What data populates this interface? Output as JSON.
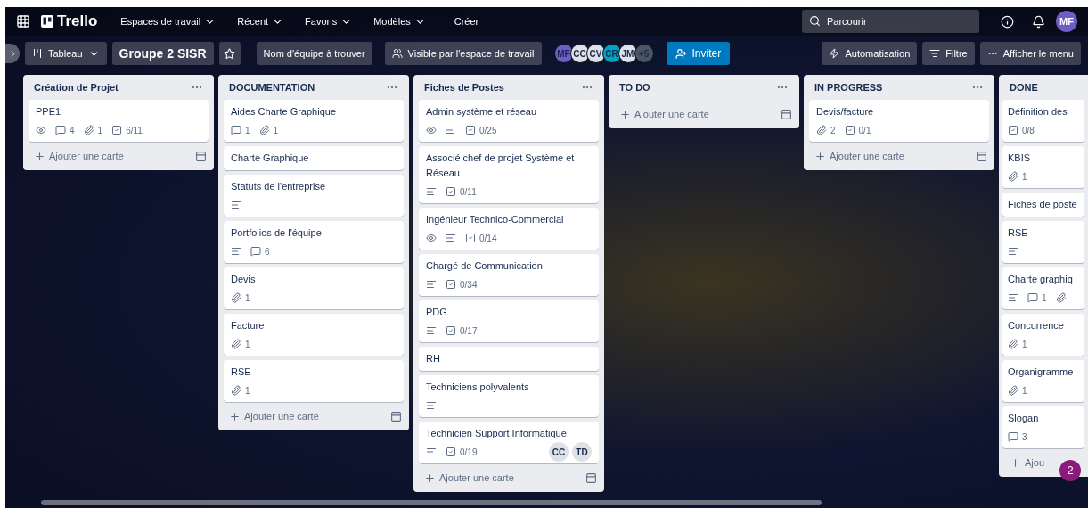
{
  "topbar": {
    "logo": "Trello",
    "menus": [
      {
        "label": "Espaces de travail",
        "kind": "menu"
      },
      {
        "label": "Récent",
        "kind": "menu"
      },
      {
        "label": "Favoris",
        "kind": "menu"
      },
      {
        "label": "Modèles",
        "kind": "menu"
      },
      {
        "label": "Créer",
        "kind": "button"
      }
    ],
    "search": {
      "placeholder": "Parcourir"
    },
    "user": "MF"
  },
  "boardbar": {
    "view": "Tableau",
    "title": "Groupe 2 SISR",
    "team": "Nom d'équipe à trouver",
    "visibility": "Visible par l'espace de travail",
    "members": [
      {
        "initials": "MF",
        "color": "#6e5dc6"
      },
      {
        "initials": "CC",
        "color": "#dfe1e6"
      },
      {
        "initials": "CV",
        "color": "#dfe1e6"
      },
      {
        "initials": "CR",
        "color": "#00a3bf"
      },
      {
        "initials": "JM",
        "color": "#dfe1e6"
      },
      {
        "initials": "+5",
        "color": "#4b5563"
      }
    ],
    "invite": "Inviter",
    "automation": "Automatisation",
    "filter": "Filtre",
    "menu": "Afficher le menu"
  },
  "lists": [
    {
      "title": "Création de Projet",
      "cards": [
        {
          "title": "PPE1",
          "badges": [
            {
              "kind": "watch"
            },
            {
              "kind": "comments",
              "count": "4"
            },
            {
              "kind": "attachments",
              "count": "1"
            },
            {
              "kind": "checklist",
              "count": "6/11"
            }
          ]
        }
      ],
      "add": "Ajouter une carte"
    },
    {
      "title": "DOCUMENTATION",
      "cards": [
        {
          "title": "Aides Charte Graphique",
          "badges": [
            {
              "kind": "comments",
              "count": "1"
            },
            {
              "kind": "attachments",
              "count": "1"
            }
          ]
        },
        {
          "title": "Charte Graphique"
        },
        {
          "title": "Statuts de l'entreprise",
          "badges": [
            {
              "kind": "description"
            }
          ]
        },
        {
          "title": "Portfolios de l'équipe",
          "badges": [
            {
              "kind": "description"
            },
            {
              "kind": "comments",
              "count": "6"
            }
          ]
        },
        {
          "title": "Devis",
          "badges": [
            {
              "kind": "attachments",
              "count": "1"
            }
          ]
        },
        {
          "title": "Facture",
          "badges": [
            {
              "kind": "attachments",
              "count": "1"
            }
          ]
        },
        {
          "title": "RSE",
          "badges": [
            {
              "kind": "attachments",
              "count": "1"
            }
          ]
        }
      ],
      "add": "Ajouter une carte"
    },
    {
      "title": "Fiches de Postes",
      "cards": [
        {
          "title": "Admin système et réseau",
          "badges": [
            {
              "kind": "watch"
            },
            {
              "kind": "description"
            },
            {
              "kind": "checklist",
              "count": "0/25"
            }
          ]
        },
        {
          "title": "Associé chef de projet Système et Réseau",
          "badges": [
            {
              "kind": "description"
            },
            {
              "kind": "checklist",
              "count": "0/11"
            }
          ]
        },
        {
          "title": "Ingénieur Technico-Commercial",
          "badges": [
            {
              "kind": "watch"
            },
            {
              "kind": "description"
            },
            {
              "kind": "checklist",
              "count": "0/14"
            }
          ]
        },
        {
          "title": "Chargé de Communication",
          "badges": [
            {
              "kind": "description"
            },
            {
              "kind": "checklist",
              "count": "0/34"
            }
          ]
        },
        {
          "title": "PDG",
          "badges": [
            {
              "kind": "description"
            },
            {
              "kind": "checklist",
              "count": "0/17"
            }
          ]
        },
        {
          "title": "RH"
        },
        {
          "title": "Techniciens polyvalents",
          "badges": [
            {
              "kind": "description"
            }
          ]
        },
        {
          "title": "Technicien Support Informatique",
          "badges": [
            {
              "kind": "description"
            },
            {
              "kind": "checklist",
              "count": "0/19"
            }
          ],
          "members": [
            "CC",
            "TD"
          ]
        }
      ],
      "add": "Ajouter une carte"
    },
    {
      "title": "TO DO",
      "add": "Ajouter une carte"
    },
    {
      "title": "IN PROGRESS",
      "cards": [
        {
          "title": "Devis/facture",
          "badges": [
            {
              "kind": "attachments",
              "count": "2"
            },
            {
              "kind": "checklist",
              "count": "0/1"
            }
          ]
        }
      ],
      "add": "Ajouter une carte"
    },
    {
      "title": "DONE",
      "cards": [
        {
          "title": "Définition des",
          "badges": [
            {
              "kind": "checklist",
              "count": "0/8"
            }
          ]
        },
        {
          "title": "KBIS",
          "badges": [
            {
              "kind": "attachments",
              "count": "1"
            }
          ]
        },
        {
          "title": "Fiches de poste"
        },
        {
          "title": "RSE",
          "badges": [
            {
              "kind": "description"
            }
          ]
        },
        {
          "title": "Charte graphiq",
          "badges": [
            {
              "kind": "description"
            },
            {
              "kind": "comments",
              "count": "1"
            },
            {
              "kind": "attachments"
            }
          ]
        },
        {
          "title": "Concurrence",
          "badges": [
            {
              "kind": "attachments",
              "count": "1"
            }
          ]
        },
        {
          "title": "Organigramme",
          "badges": [
            {
              "kind": "attachments",
              "count": "1"
            }
          ]
        },
        {
          "title": "Slogan",
          "badges": [
            {
              "kind": "comments",
              "count": "3"
            }
          ]
        }
      ],
      "add": "Ajou"
    }
  ],
  "notification": "2"
}
